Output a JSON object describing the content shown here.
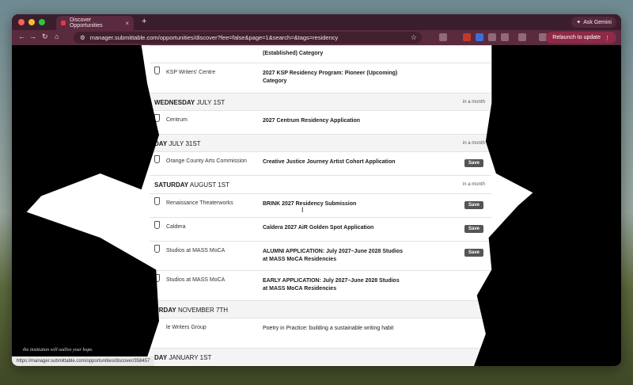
{
  "browser": {
    "tab_title": "Discover Opportunities",
    "new_tab": "+",
    "ask_gemini": "Ask Gemini",
    "url": "manager.submittable.com/opportunities/discover?fee=false&page=1&search=&tags=residency",
    "relaunch": "Relaunch to update",
    "status_url": "https://manager.submittable.com/opportunities/discover/358457"
  },
  "tagline": "the institution will outlive your hope.",
  "feed": {
    "save_label": "Save",
    "rows": [
      {
        "org": "",
        "title": "(Established) Category"
      },
      {
        "org": "KSP Writers' Centre",
        "title": "2027 KSP Residency Program: Pioneer (Upcoming) Category"
      },
      {
        "day_bold": "WEDNESDAY",
        "day_rest": "JULY 1ST",
        "when": "in a month"
      },
      {
        "org": "Centrum",
        "title": "2027 Centrum Residency Application"
      },
      {
        "day_bold": "DAY",
        "day_rest": "JULY 31ST",
        "when": "in a month"
      },
      {
        "org": "Orange County Arts Commission",
        "title": "Creative Justice Journey Artist Cohort Application"
      },
      {
        "day_bold": "SATURDAY",
        "day_rest": "AUGUST 1ST",
        "when": "in a month"
      },
      {
        "org": "Renaissance Theaterworks",
        "title": "BRINK 2027 Residency Submission"
      },
      {
        "org": "Caldera",
        "title": "Caldera 2027 AiR Golden Spot Application"
      },
      {
        "org": "Studios at MASS MoCA",
        "title": "ALUMNI APPLICATION: July 2027–June 2028 Studios at MASS MoCA Residencies"
      },
      {
        "org": "Studios at MASS MoCA",
        "title": "EARLY APPLICATION: July 2027–June 2028 Studios at MASS MoCA Residencies"
      },
      {
        "day_bold": "URDAY",
        "day_rest": "NOVEMBER 7TH",
        "when": ""
      },
      {
        "org": "le Writers Group",
        "title": "Poetry in Practice: building a sustainable writing habit"
      },
      {
        "day_bold": "DAY",
        "day_rest": "JANUARY 1ST",
        "when": ""
      }
    ]
  }
}
